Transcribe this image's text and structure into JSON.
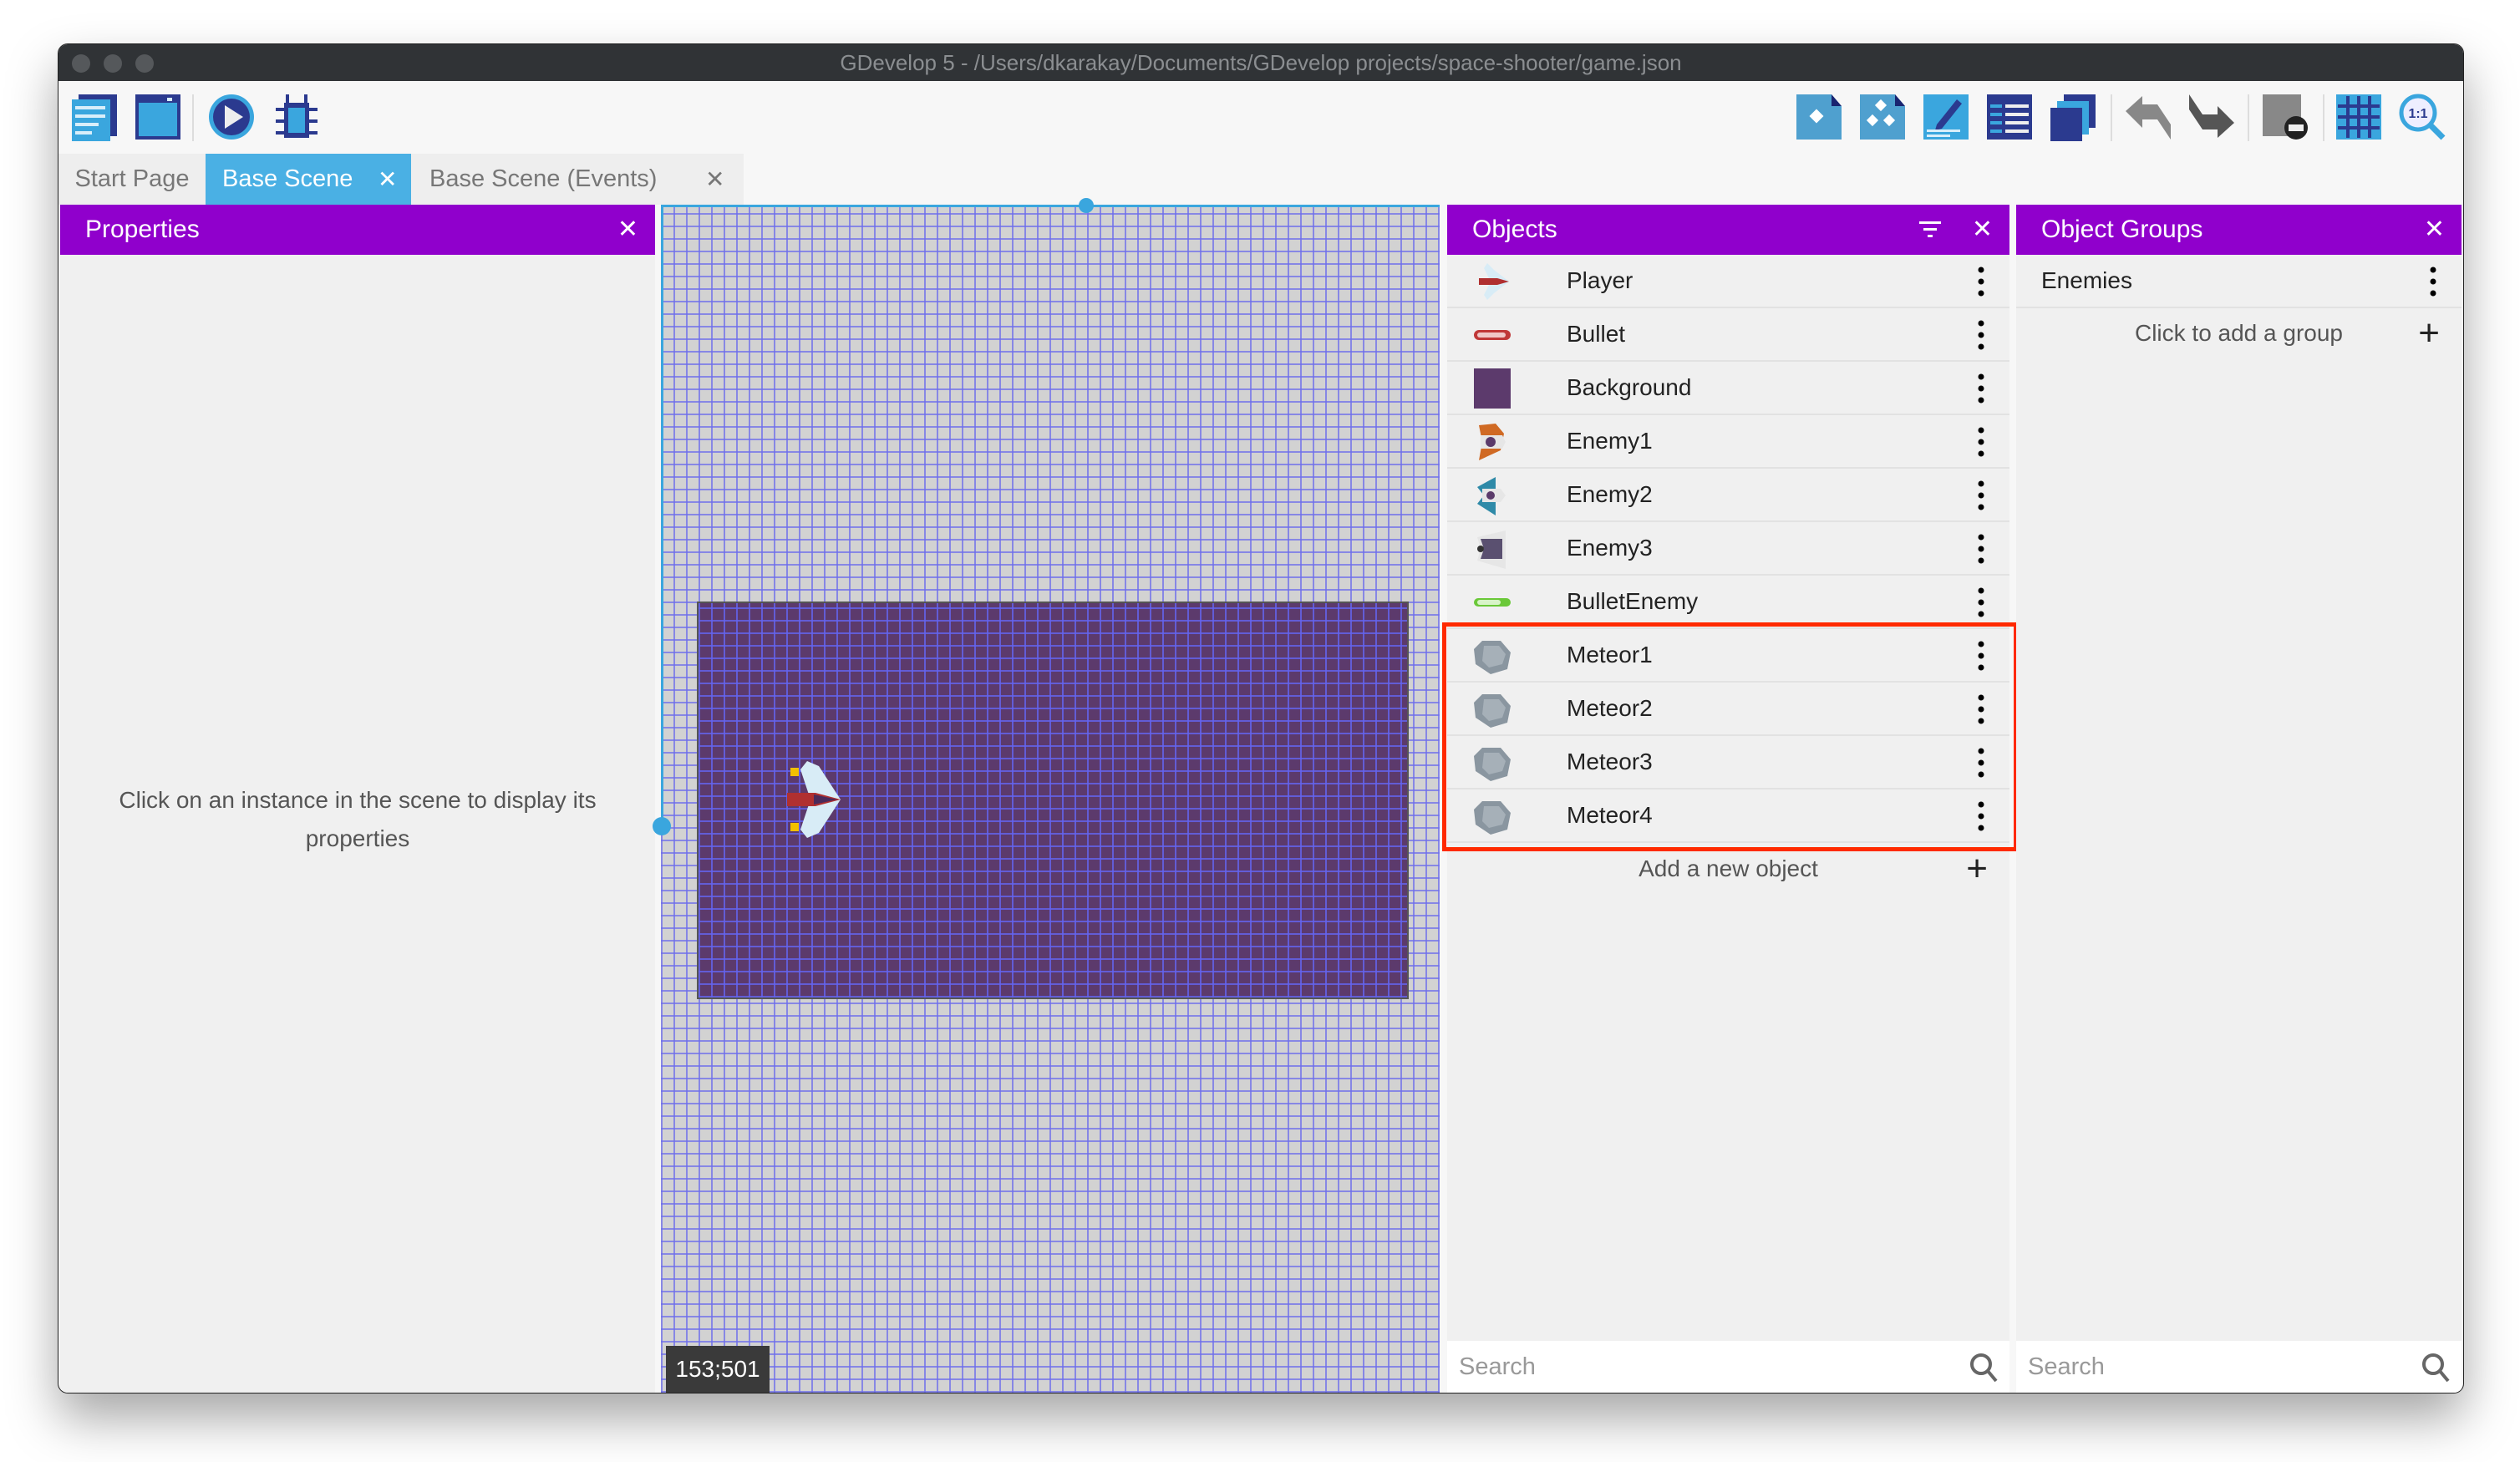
{
  "window": {
    "title": "GDevelop 5 - /Users/dkarakay/Documents/GDevelop projects/space-shooter/game.json"
  },
  "toolbar": {
    "left_icons": [
      "project-manager-icon",
      "scene-icon",
      "preview-play-icon",
      "debugger-icon"
    ],
    "right_icons": [
      "object-icon",
      "object-groups-icon",
      "properties-edit-icon",
      "layers-icon",
      "instances-list-icon",
      "undo-icon",
      "redo-icon",
      "delete-instance-icon",
      "grid-icon",
      "zoom-reset-icon"
    ]
  },
  "tabs": [
    {
      "label": "Start Page",
      "active": false
    },
    {
      "label": "Base Scene",
      "active": true
    },
    {
      "label": "Base Scene (Events)",
      "active": false
    }
  ],
  "properties": {
    "title": "Properties",
    "empty_text": "Click on an instance in the scene to display its properties"
  },
  "canvas": {
    "coordinates": "153;501"
  },
  "objects": {
    "title": "Objects",
    "items": [
      {
        "name": "Player",
        "icon": "player-ship-icon"
      },
      {
        "name": "Bullet",
        "icon": "bullet-icon"
      },
      {
        "name": "Background",
        "icon": "background-icon"
      },
      {
        "name": "Enemy1",
        "icon": "enemy1-icon"
      },
      {
        "name": "Enemy2",
        "icon": "enemy2-icon"
      },
      {
        "name": "Enemy3",
        "icon": "enemy3-icon"
      },
      {
        "name": "BulletEnemy",
        "icon": "enemy-bullet-icon"
      },
      {
        "name": "Meteor1",
        "icon": "meteor-icon"
      },
      {
        "name": "Meteor2",
        "icon": "meteor-icon"
      },
      {
        "name": "Meteor3",
        "icon": "meteor-icon"
      },
      {
        "name": "Meteor4",
        "icon": "meteor-icon"
      }
    ],
    "add_label": "Add a new object",
    "search_placeholder": "Search"
  },
  "groups": {
    "title": "Object Groups",
    "items": [
      {
        "name": "Enemies"
      }
    ],
    "add_label": "Click to add a group",
    "search_placeholder": "Search"
  },
  "colors": {
    "panel_header": "#9000cc",
    "active_tab": "#4ab0e4",
    "highlight": "#ff2a00",
    "scene_background": "#5c3a6c"
  }
}
